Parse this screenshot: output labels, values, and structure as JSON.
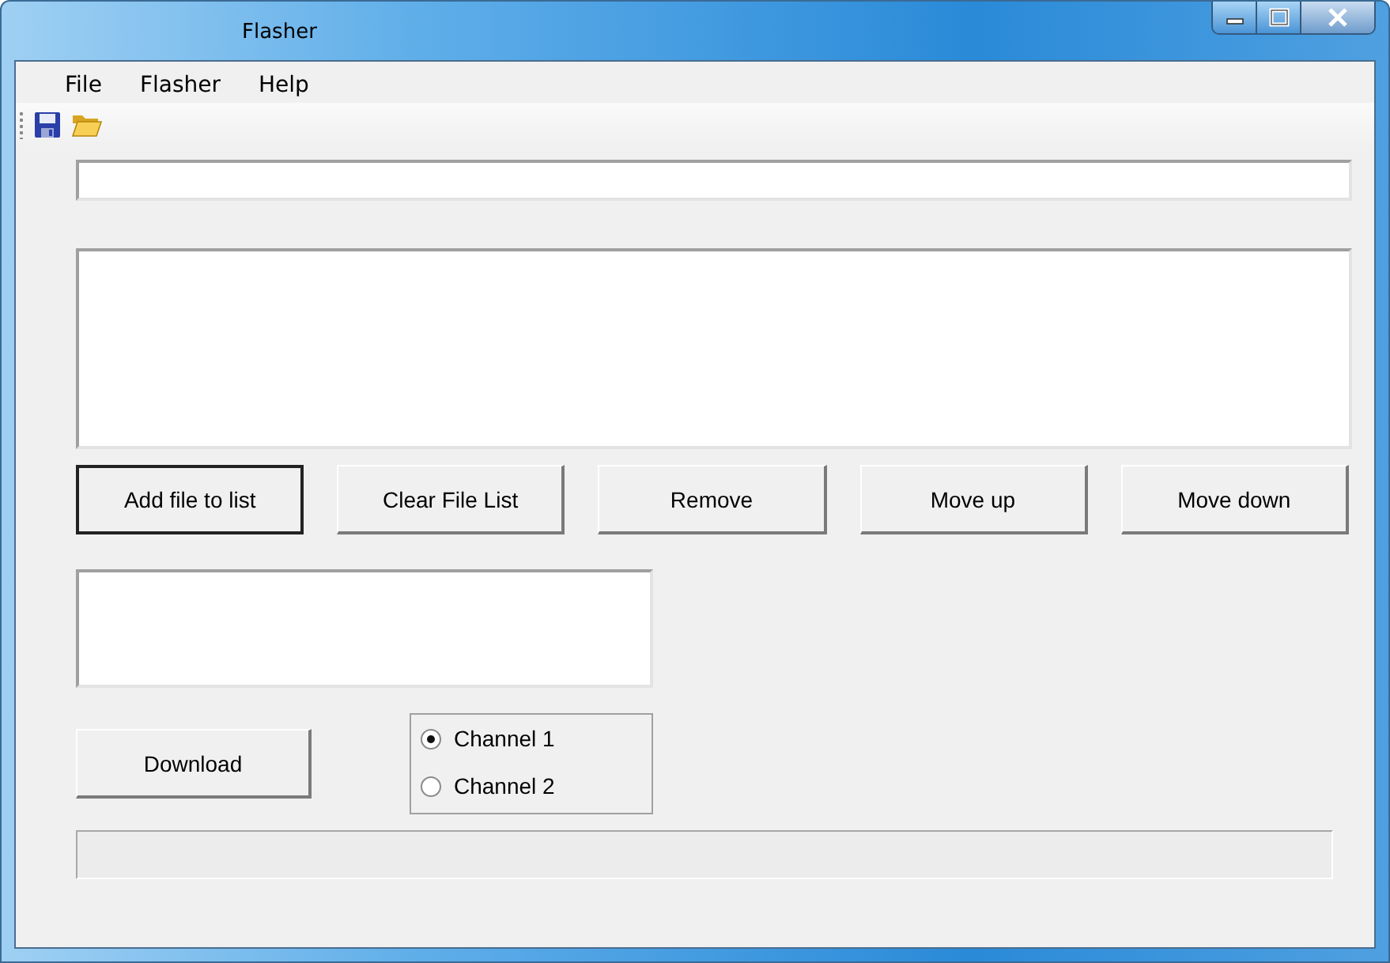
{
  "window": {
    "title": "Flasher"
  },
  "menu": [
    "File",
    "Flasher",
    "Help"
  ],
  "toolbar": [
    {
      "kind": "save"
    },
    {
      "kind": "open"
    }
  ],
  "buttons": [
    {
      "label": "Add file to list",
      "focused": true
    },
    {
      "label": "Clear File List",
      "focused": false
    },
    {
      "label": "Remove",
      "focused": false
    },
    {
      "label": "Move up",
      "focused": false
    },
    {
      "label": "Move down",
      "focused": false
    }
  ],
  "download_button": {
    "label": "Download"
  },
  "channels": [
    {
      "label": "Channel 1",
      "selected": true
    },
    {
      "label": "Channel 2",
      "selected": false
    }
  ],
  "progress": {
    "level": 0
  }
}
